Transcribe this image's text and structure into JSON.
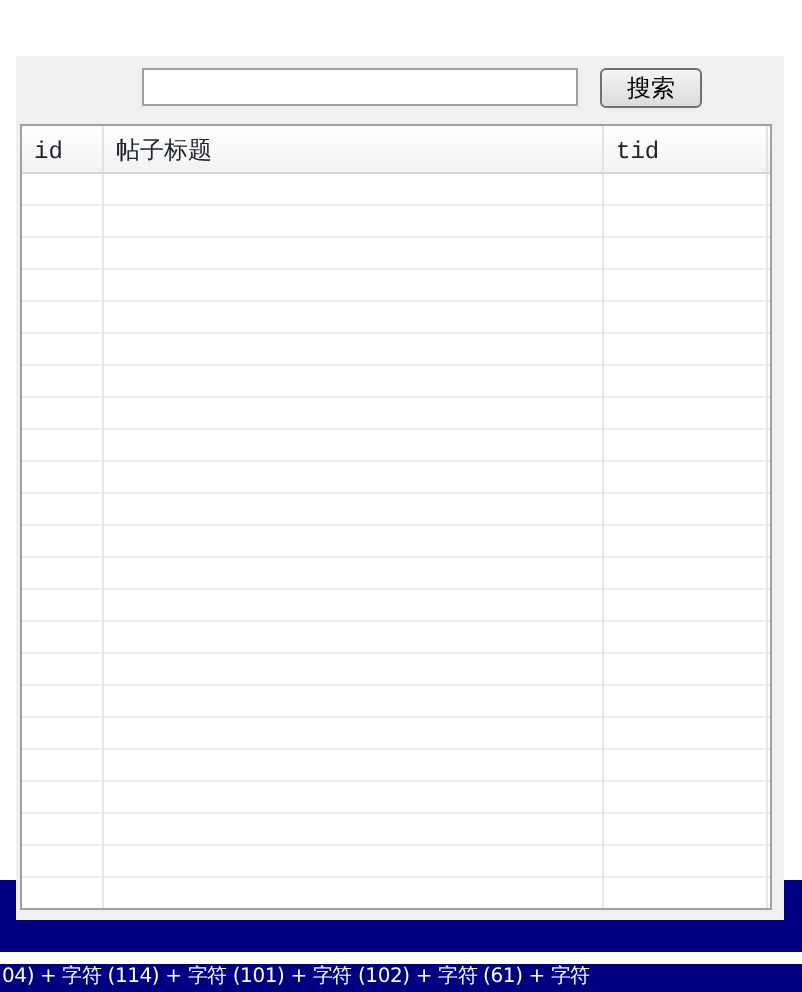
{
  "search_button": "搜索",
  "table": {
    "columns": [
      "id",
      "帖子标题",
      "tid"
    ]
  },
  "background_code": "04) + 字符 (114) + 字符 (101) + 字符 (102) + 字符 (61) + 字符"
}
